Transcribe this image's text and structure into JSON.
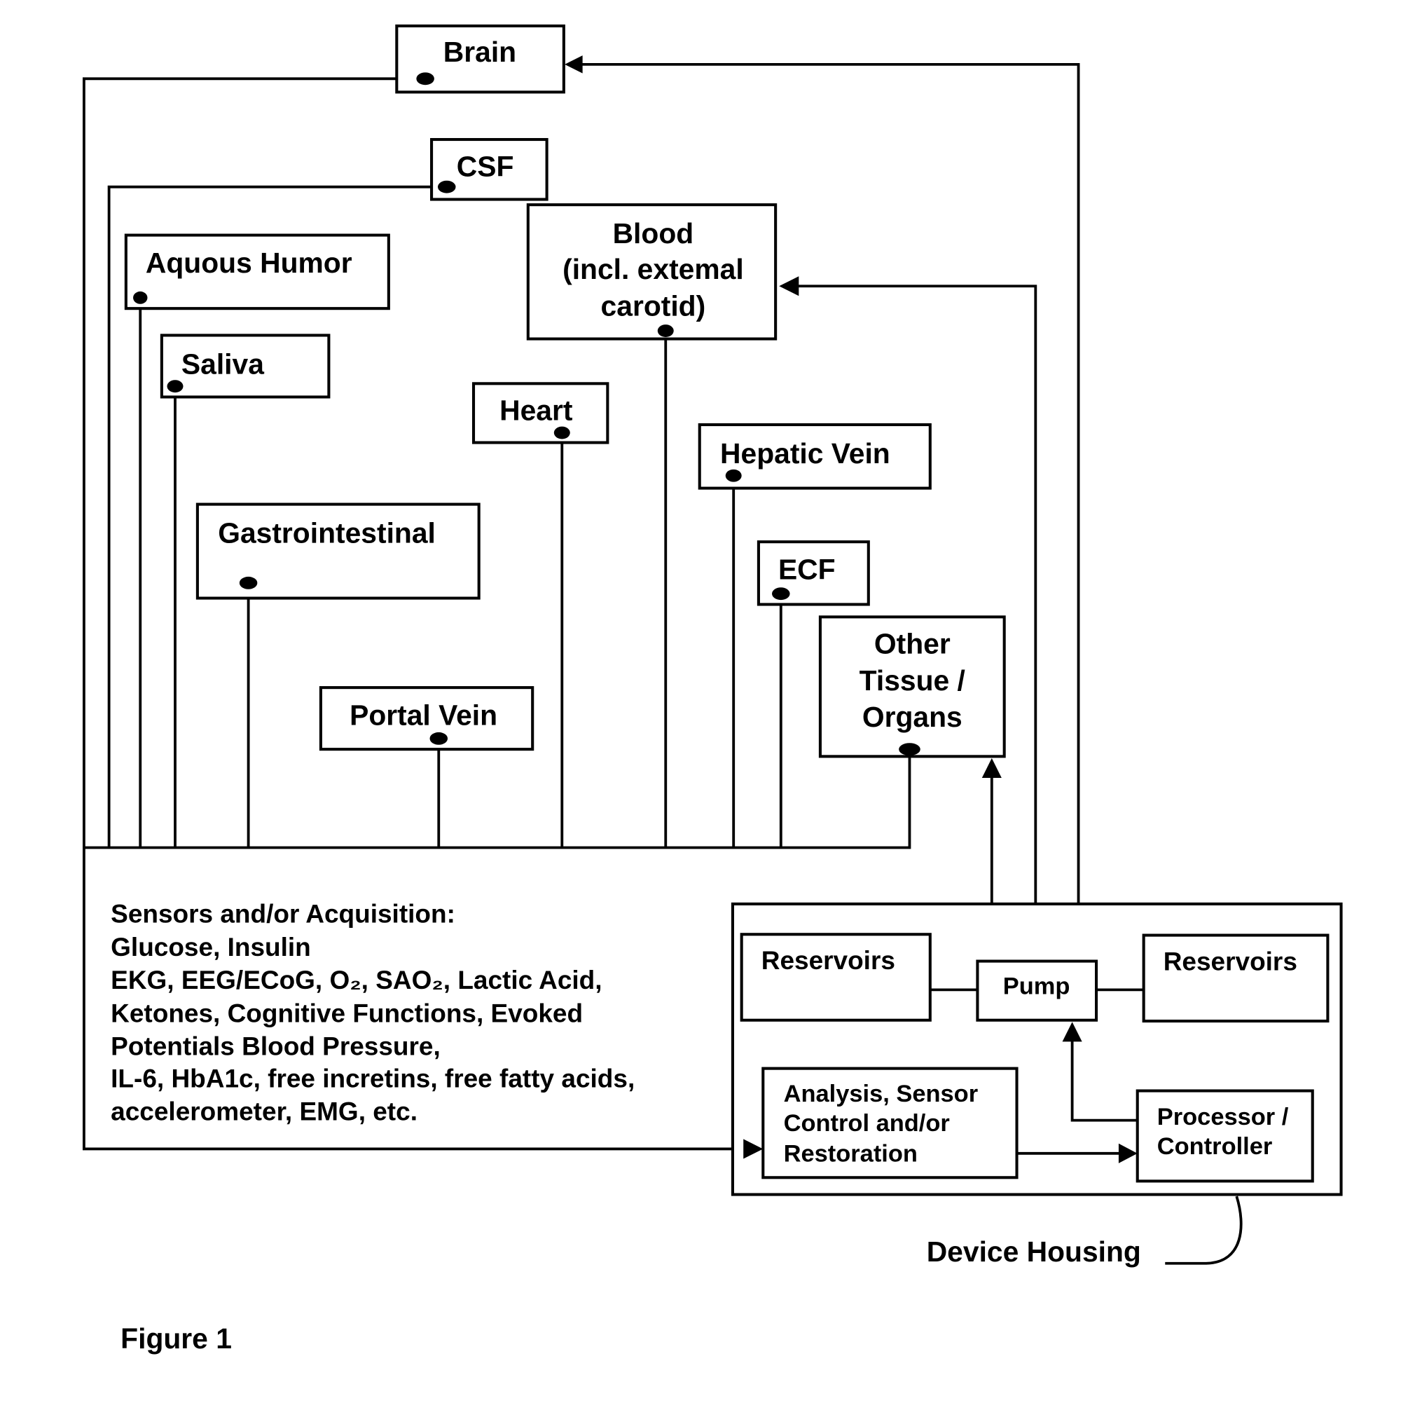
{
  "figure": {
    "caption": "Figure 1",
    "callout_label": "Device Housing"
  },
  "targets": {
    "brain": {
      "label": "Brain"
    },
    "csf": {
      "label": "CSF"
    },
    "aqueous_humor": {
      "label": "Aquous Humor"
    },
    "saliva": {
      "label": "Saliva"
    },
    "blood": {
      "lines": [
        "Blood",
        "(incl. extemal",
        "carotid)"
      ]
    },
    "heart": {
      "label": "Heart"
    },
    "hepatic_vein": {
      "label": "Hepatic Vein"
    },
    "gastrointestinal": {
      "label": "Gastrointestinal"
    },
    "ecf": {
      "label": "ECF"
    },
    "other_tissue": {
      "lines": [
        "Other",
        "Tissue /",
        "Organs"
      ]
    },
    "portal_vein": {
      "label": "Portal Vein"
    }
  },
  "sensors": {
    "lines": [
      "Sensors and/or Acquisition:",
      "Glucose, Insulin",
      "EKG, EEG/ECoG, O₂, SAO₂, Lactic Acid,",
      "Ketones, Cognitive Functions, Evoked",
      "Potentials Blood Pressure,",
      "IL-6, HbA1c, free incretins, free fatty acids,",
      "accelerometer, EMG, etc."
    ]
  },
  "device": {
    "reservoirs_left": "Reservoirs",
    "pump": "Pump",
    "reservoirs_right": "Reservoirs",
    "analysis": [
      "Analysis, Sensor",
      "Control and/or",
      "Restoration"
    ],
    "processor": [
      "Processor /",
      "Controller"
    ]
  }
}
